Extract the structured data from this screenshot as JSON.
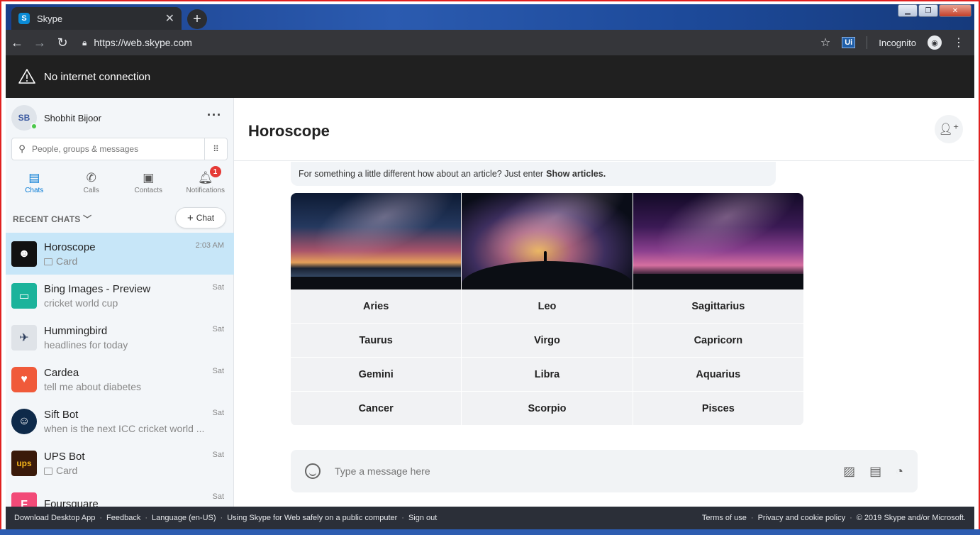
{
  "browser": {
    "tab_title": "Skype",
    "tab_favicon": "S",
    "url": "https://web.skype.com",
    "extension_label": "Ui",
    "incognito_label": "Incognito"
  },
  "banner": {
    "text": "No internet connection"
  },
  "profile": {
    "initials": "SB",
    "name": "Shobhit Bijoor"
  },
  "search": {
    "placeholder": "People, groups & messages"
  },
  "nav": {
    "tabs": [
      {
        "label": "Chats"
      },
      {
        "label": "Calls"
      },
      {
        "label": "Contacts"
      },
      {
        "label": "Notifications",
        "badge": "1"
      }
    ]
  },
  "recent": {
    "header": "RECENT CHATS",
    "new_chat": "Chat"
  },
  "chats": [
    {
      "name": "Horoscope",
      "message": "Card",
      "time": "2:03 AM",
      "color": "#111111"
    },
    {
      "name": "Bing Images - Preview",
      "message": "cricket world cup",
      "time": "Sat",
      "color": "#1bb39b"
    },
    {
      "name": "Hummingbird",
      "message": "headlines for today",
      "time": "Sat",
      "color": "#dfe3e8"
    },
    {
      "name": "Cardea",
      "message": "tell me about diabetes",
      "time": "Sat",
      "color": "#f05a3a"
    },
    {
      "name": "Sift Bot",
      "message": "when is the next ICC cricket world ...",
      "time": "Sat",
      "color": "#0e2a4a"
    },
    {
      "name": "UPS Bot",
      "message": "Card",
      "time": "Sat",
      "color": "#3a1a0a"
    },
    {
      "name": "Foursquare",
      "message": "",
      "time": "Sat",
      "color": "#f24a78"
    }
  ],
  "conversation": {
    "title": "Horoscope",
    "bubble_text": "For something a little different how about an article? Just enter",
    "bubble_bold": "Show articles.",
    "signs": [
      "Aries",
      "Leo",
      "Sagittarius",
      "Taurus",
      "Virgo",
      "Capricorn",
      "Gemini",
      "Libra",
      "Aquarius",
      "Cancer",
      "Scorpio",
      "Pisces"
    ],
    "compose_placeholder": "Type a message here"
  },
  "footer": {
    "left": [
      "Download Desktop App",
      "Feedback",
      "Language (en-US)",
      "Using Skype for Web safely on a public computer",
      "Sign out"
    ],
    "right": [
      "Terms of use",
      "Privacy and cookie policy",
      "© 2019 Skype and/or Microsoft."
    ]
  },
  "colors": {
    "accent": "#0078d4",
    "active_chat": "#c7e6f8",
    "banner": "#202020"
  }
}
